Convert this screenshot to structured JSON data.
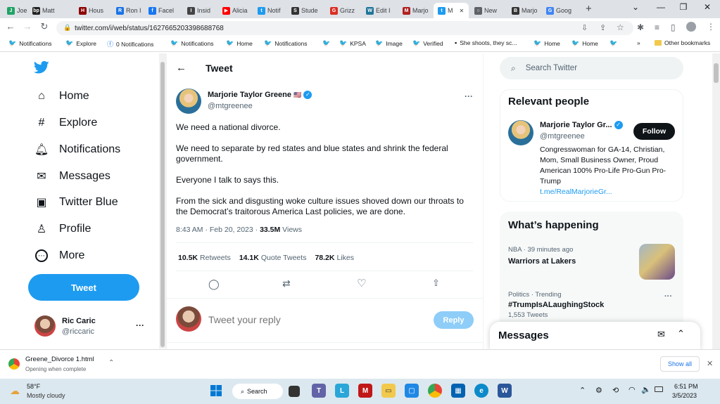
{
  "browser": {
    "tabs": [
      {
        "label": "Joe M",
        "color": "#21a366",
        "glyph": "J"
      },
      {
        "label": "Matt",
        "color": "#222222",
        "glyph": "bp"
      },
      {
        "label": "Hous",
        "color": "#8b0000",
        "glyph": "H"
      },
      {
        "label": "Ron I",
        "color": "#1a73e8",
        "glyph": "R"
      },
      {
        "label": "Facel",
        "color": "#1877f2",
        "glyph": "f"
      },
      {
        "label": "Insid",
        "color": "#444444",
        "glyph": "I"
      },
      {
        "label": "Alicia",
        "color": "#ff0000",
        "glyph": "▶"
      },
      {
        "label": "Notif",
        "color": "#1d9bf0",
        "glyph": "t"
      },
      {
        "label": "Stude",
        "color": "#333333",
        "glyph": "S"
      },
      {
        "label": "Grizz",
        "color": "#d93025",
        "glyph": "G"
      },
      {
        "label": "Edit I",
        "color": "#21759b",
        "glyph": "W"
      },
      {
        "label": "Marjo",
        "color": "#b02020",
        "glyph": "M"
      },
      {
        "label": "M",
        "color": "#1d9bf0",
        "glyph": "t"
      },
      {
        "label": "New",
        "color": "#5f6368",
        "glyph": "○"
      },
      {
        "label": "Marjo",
        "color": "#333333",
        "glyph": "B"
      },
      {
        "label": "Goog",
        "color": "#4285f4",
        "glyph": "G"
      }
    ],
    "new_tab": "+",
    "url": "twitter.com/i/web/status/1627665203398688768",
    "bookmarks": [
      "Notifications",
      "Explore",
      "0 Notifications",
      "Notifications",
      "Home",
      "Notifications",
      "",
      "KPSA",
      "Image",
      "Verified",
      "She shoots, they sc...",
      "Home",
      "Home",
      ""
    ],
    "bookmarks_more": "»",
    "other_bookmarks": "Other bookmarks"
  },
  "nav": {
    "items": [
      {
        "label": "Home",
        "icon": "home-icon"
      },
      {
        "label": "Explore",
        "icon": "hashtag-icon"
      },
      {
        "label": "Notifications",
        "icon": "bell-icon"
      },
      {
        "label": "Messages",
        "icon": "mail-icon"
      },
      {
        "label": "Twitter Blue",
        "icon": "twitter-blue-icon"
      },
      {
        "label": "Profile",
        "icon": "person-icon"
      },
      {
        "label": "More",
        "icon": "more-circle-icon"
      }
    ],
    "tweet_button": "Tweet",
    "account_name": "Ric Caric",
    "account_handle": "@riccaric",
    "account_more": "···"
  },
  "main": {
    "header_title": "Tweet",
    "author_name": "Marjorie Taylor Greene",
    "author_handle": "@mtgreenee",
    "flag": "🇺🇸",
    "paragraphs": [
      "We need a national divorce.",
      "We need to separate by red states and blue states and shrink the federal government.",
      "Everyone I talk to says this.",
      "From the sick and disgusting woke culture issues shoved down our throats to the Democrat’s traitorous America Last policies, we are done."
    ],
    "timestamp": "8:43 AM · Feb 20, 2023 · ",
    "views_count": "33.5M",
    "views_label": " Views",
    "stats": [
      {
        "count": "10.5K",
        "label": "Retweets"
      },
      {
        "count": "14.1K",
        "label": "Quote Tweets"
      },
      {
        "count": "78.2K",
        "label": "Likes"
      }
    ],
    "reply_placeholder": "Tweet your reply",
    "reply_button": "Reply",
    "more": "···"
  },
  "right": {
    "search_placeholder": "Search Twitter",
    "relevant_title": "Relevant people",
    "person_name": "Marjorie Taylor Gr...",
    "person_handle": "@mtgreenee",
    "follow_label": "Follow",
    "bio": "Congresswoman for GA-14, Christian, Mom, Small Business Owner, Proud American 100% Pro-Life Pro-Gun Pro-Trump",
    "bio_link": "t.me/RealMarjorieGr...",
    "happening_title": "What’s happening",
    "trends": [
      {
        "meta": "NBA · 39 minutes ago",
        "title": "Warriors at Lakers"
      },
      {
        "meta": "Politics · Trending",
        "title": "#TrumpIsALaughingStock",
        "count": "1,553 Tweets"
      }
    ],
    "messages_title": "Messages"
  },
  "download": {
    "filename": "Greene_Divorce 1.html",
    "status": "Opening when complete",
    "show_all": "Show all",
    "close": "✕"
  },
  "taskbar": {
    "weather_temp": "58°F",
    "weather_desc": "Mostly cloudy",
    "search": "Search",
    "time": "6:51 PM",
    "date": "3/5/2023"
  }
}
